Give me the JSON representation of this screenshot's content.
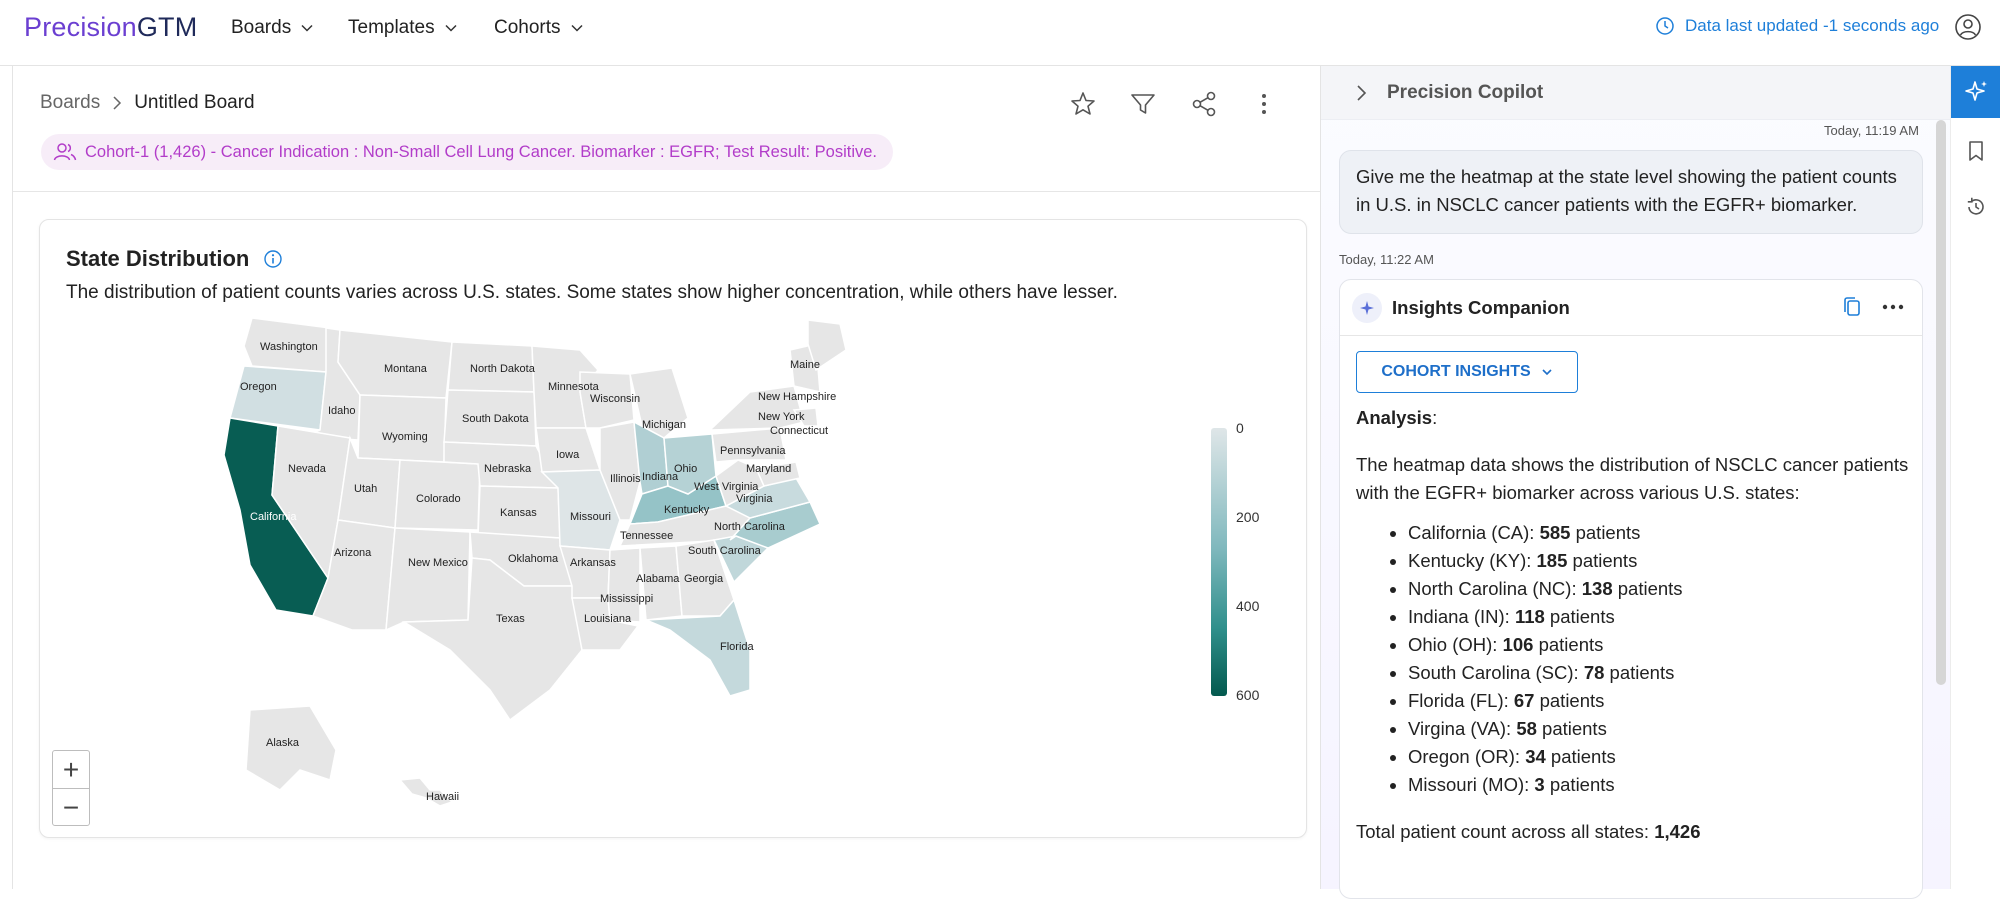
{
  "app": {
    "logo_part1": "Precision",
    "logo_part2": "GTM",
    "nav": [
      {
        "label": "Boards"
      },
      {
        "label": "Templates"
      },
      {
        "label": "Cohorts"
      }
    ],
    "status_text": "Data last updated -1 seconds ago",
    "accent": "#1e7fd9",
    "brand": "#6b3fd1"
  },
  "board": {
    "breadcrumb_root": "Boards",
    "breadcrumb_current": "Untitled Board",
    "toolbar_icons": [
      "star-icon",
      "filter-icon",
      "share-icon",
      "more-vertical-icon"
    ],
    "cohort_chip": "Cohort-1 (1,426) - Cancer Indication : Non-Small Cell Lung Cancer. Biomarker : EGFR; Test Result: Positive."
  },
  "card": {
    "title": "State Distribution",
    "description": "The distribution of patient counts varies across U.S. states. Some states show higher concentration, while others have lesser.",
    "legend_ticks": [
      "0",
      "200",
      "400",
      "600"
    ]
  },
  "map": {
    "states": [
      {
        "name": "Washington",
        "value": 0
      },
      {
        "name": "Oregon",
        "value": 34
      },
      {
        "name": "California",
        "value": 585
      },
      {
        "name": "Idaho",
        "value": 0
      },
      {
        "name": "Nevada",
        "value": 0
      },
      {
        "name": "Montana",
        "value": 0
      },
      {
        "name": "Wyoming",
        "value": 0
      },
      {
        "name": "Utah",
        "value": 0
      },
      {
        "name": "Arizona",
        "value": 0
      },
      {
        "name": "Colorado",
        "value": 0
      },
      {
        "name": "New Mexico",
        "value": 0
      },
      {
        "name": "North Dakota",
        "value": 0
      },
      {
        "name": "South Dakota",
        "value": 0
      },
      {
        "name": "Nebraska",
        "value": 0
      },
      {
        "name": "Kansas",
        "value": 0
      },
      {
        "name": "Oklahoma",
        "value": 0
      },
      {
        "name": "Texas",
        "value": 0
      },
      {
        "name": "Minnesota",
        "value": 0
      },
      {
        "name": "Iowa",
        "value": 0
      },
      {
        "name": "Missouri",
        "value": 3
      },
      {
        "name": "Arkansas",
        "value": 0
      },
      {
        "name": "Louisiana",
        "value": 0
      },
      {
        "name": "Wisconsin",
        "value": 0
      },
      {
        "name": "Illinois",
        "value": 0
      },
      {
        "name": "Mississippi",
        "value": 0
      },
      {
        "name": "Michigan",
        "value": 0
      },
      {
        "name": "Indiana",
        "value": 118
      },
      {
        "name": "Kentucky",
        "value": 185
      },
      {
        "name": "Tennessee",
        "value": 0
      },
      {
        "name": "Alabama",
        "value": 0
      },
      {
        "name": "Ohio",
        "value": 106
      },
      {
        "name": "Georgia",
        "value": 0
      },
      {
        "name": "Florida",
        "value": 67
      },
      {
        "name": "South Carolina",
        "value": 78
      },
      {
        "name": "North Carolina",
        "value": 138
      },
      {
        "name": "Virginia",
        "value": 58
      },
      {
        "name": "West Virginia",
        "value": 0
      },
      {
        "name": "Pennsylvania",
        "value": 0
      },
      {
        "name": "Maryland",
        "value": 0
      },
      {
        "name": "New York",
        "value": 0
      },
      {
        "name": "Connecticut",
        "value": 0
      },
      {
        "name": "New Hampshire",
        "value": 0
      },
      {
        "name": "Maine",
        "value": 0
      },
      {
        "name": "Alaska",
        "value": 0
      },
      {
        "name": "Hawaii",
        "value": 0
      }
    ],
    "scale_min": 0,
    "scale_max": 600,
    "color_low": "#dfe6e8",
    "color_high": "#03594e",
    "color_nodata": "#e6e6e6"
  },
  "copilot": {
    "title": "Precision Copilot",
    "user_timestamp": "Today, 11:19 AM",
    "user_message": "Give me the heatmap at the state level showing the patient counts in U.S. in NSCLC cancer patients with the EGFR+ biomarker.",
    "response_timestamp": "Today, 11:22 AM",
    "companion_name": "Insights Companion",
    "cohort_button": "COHORT INSIGHTS",
    "analysis_heading": "Analysis",
    "analysis_intro": "The heatmap data shows the distribution of NSCLC cancer patients with the EGFR+ biomarker across various U.S. states:",
    "items": [
      {
        "state": "California (CA): ",
        "count": "585",
        "suffix": " patients"
      },
      {
        "state": "Kentucky (KY): ",
        "count": "185",
        "suffix": " patients"
      },
      {
        "state": "North Carolina (NC): ",
        "count": "138",
        "suffix": " patients"
      },
      {
        "state": "Indiana (IN): ",
        "count": "118",
        "suffix": " patients"
      },
      {
        "state": "Ohio (OH): ",
        "count": "106",
        "suffix": " patients"
      },
      {
        "state": "South Carolina (SC): ",
        "count": "78",
        "suffix": " patients"
      },
      {
        "state": "Florida (FL): ",
        "count": "67",
        "suffix": " patients"
      },
      {
        "state": "Virgina (VA): ",
        "count": "58",
        "suffix": " patients"
      },
      {
        "state": "Oregon (OR): ",
        "count": "34",
        "suffix": " patients"
      },
      {
        "state": "Missouri (MO): ",
        "count": "3",
        "suffix": " patients"
      }
    ],
    "total_label": "Total patient count across all states: ",
    "total_value": "1,426"
  }
}
